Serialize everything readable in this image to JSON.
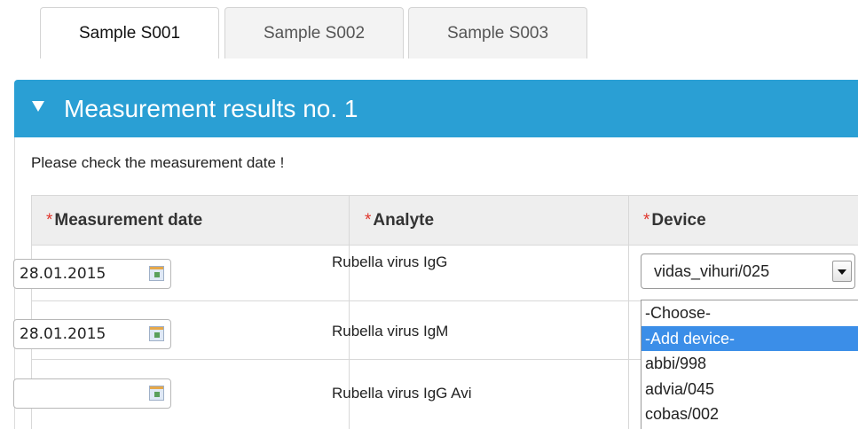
{
  "tabs": [
    {
      "label": "Sample S001",
      "active": true
    },
    {
      "label": "Sample S002",
      "active": false
    },
    {
      "label": "Sample S003",
      "active": false
    }
  ],
  "panel": {
    "title": "Measurement results no. 1",
    "notice": "Please check the measurement date !"
  },
  "table": {
    "required_marker": "*",
    "headers": {
      "date": "Measurement date",
      "analyte": "Analyte",
      "device": "Device"
    },
    "rows": [
      {
        "date": "28.01.2015",
        "analyte": "Rubella virus IgG"
      },
      {
        "date": "28.01.2015",
        "analyte": "Rubella virus IgM"
      },
      {
        "date": "",
        "analyte": "Rubella virus IgG Avi"
      }
    ]
  },
  "device_select": {
    "value": "vidas_vihuri/025",
    "options": [
      "-Choose-",
      "-Add device-",
      "abbi/998",
      "advia/045",
      "cobas/002"
    ],
    "highlighted": "-Add device-"
  },
  "colors": {
    "header_blue": "#2a9fd4",
    "highlight_blue": "#3b8ee8",
    "required_red": "#e0362c"
  },
  "icons": {
    "panel_toggle": "caret-down-icon",
    "date_picker": "calendar-icon",
    "select_toggle": "chevron-down-icon"
  }
}
